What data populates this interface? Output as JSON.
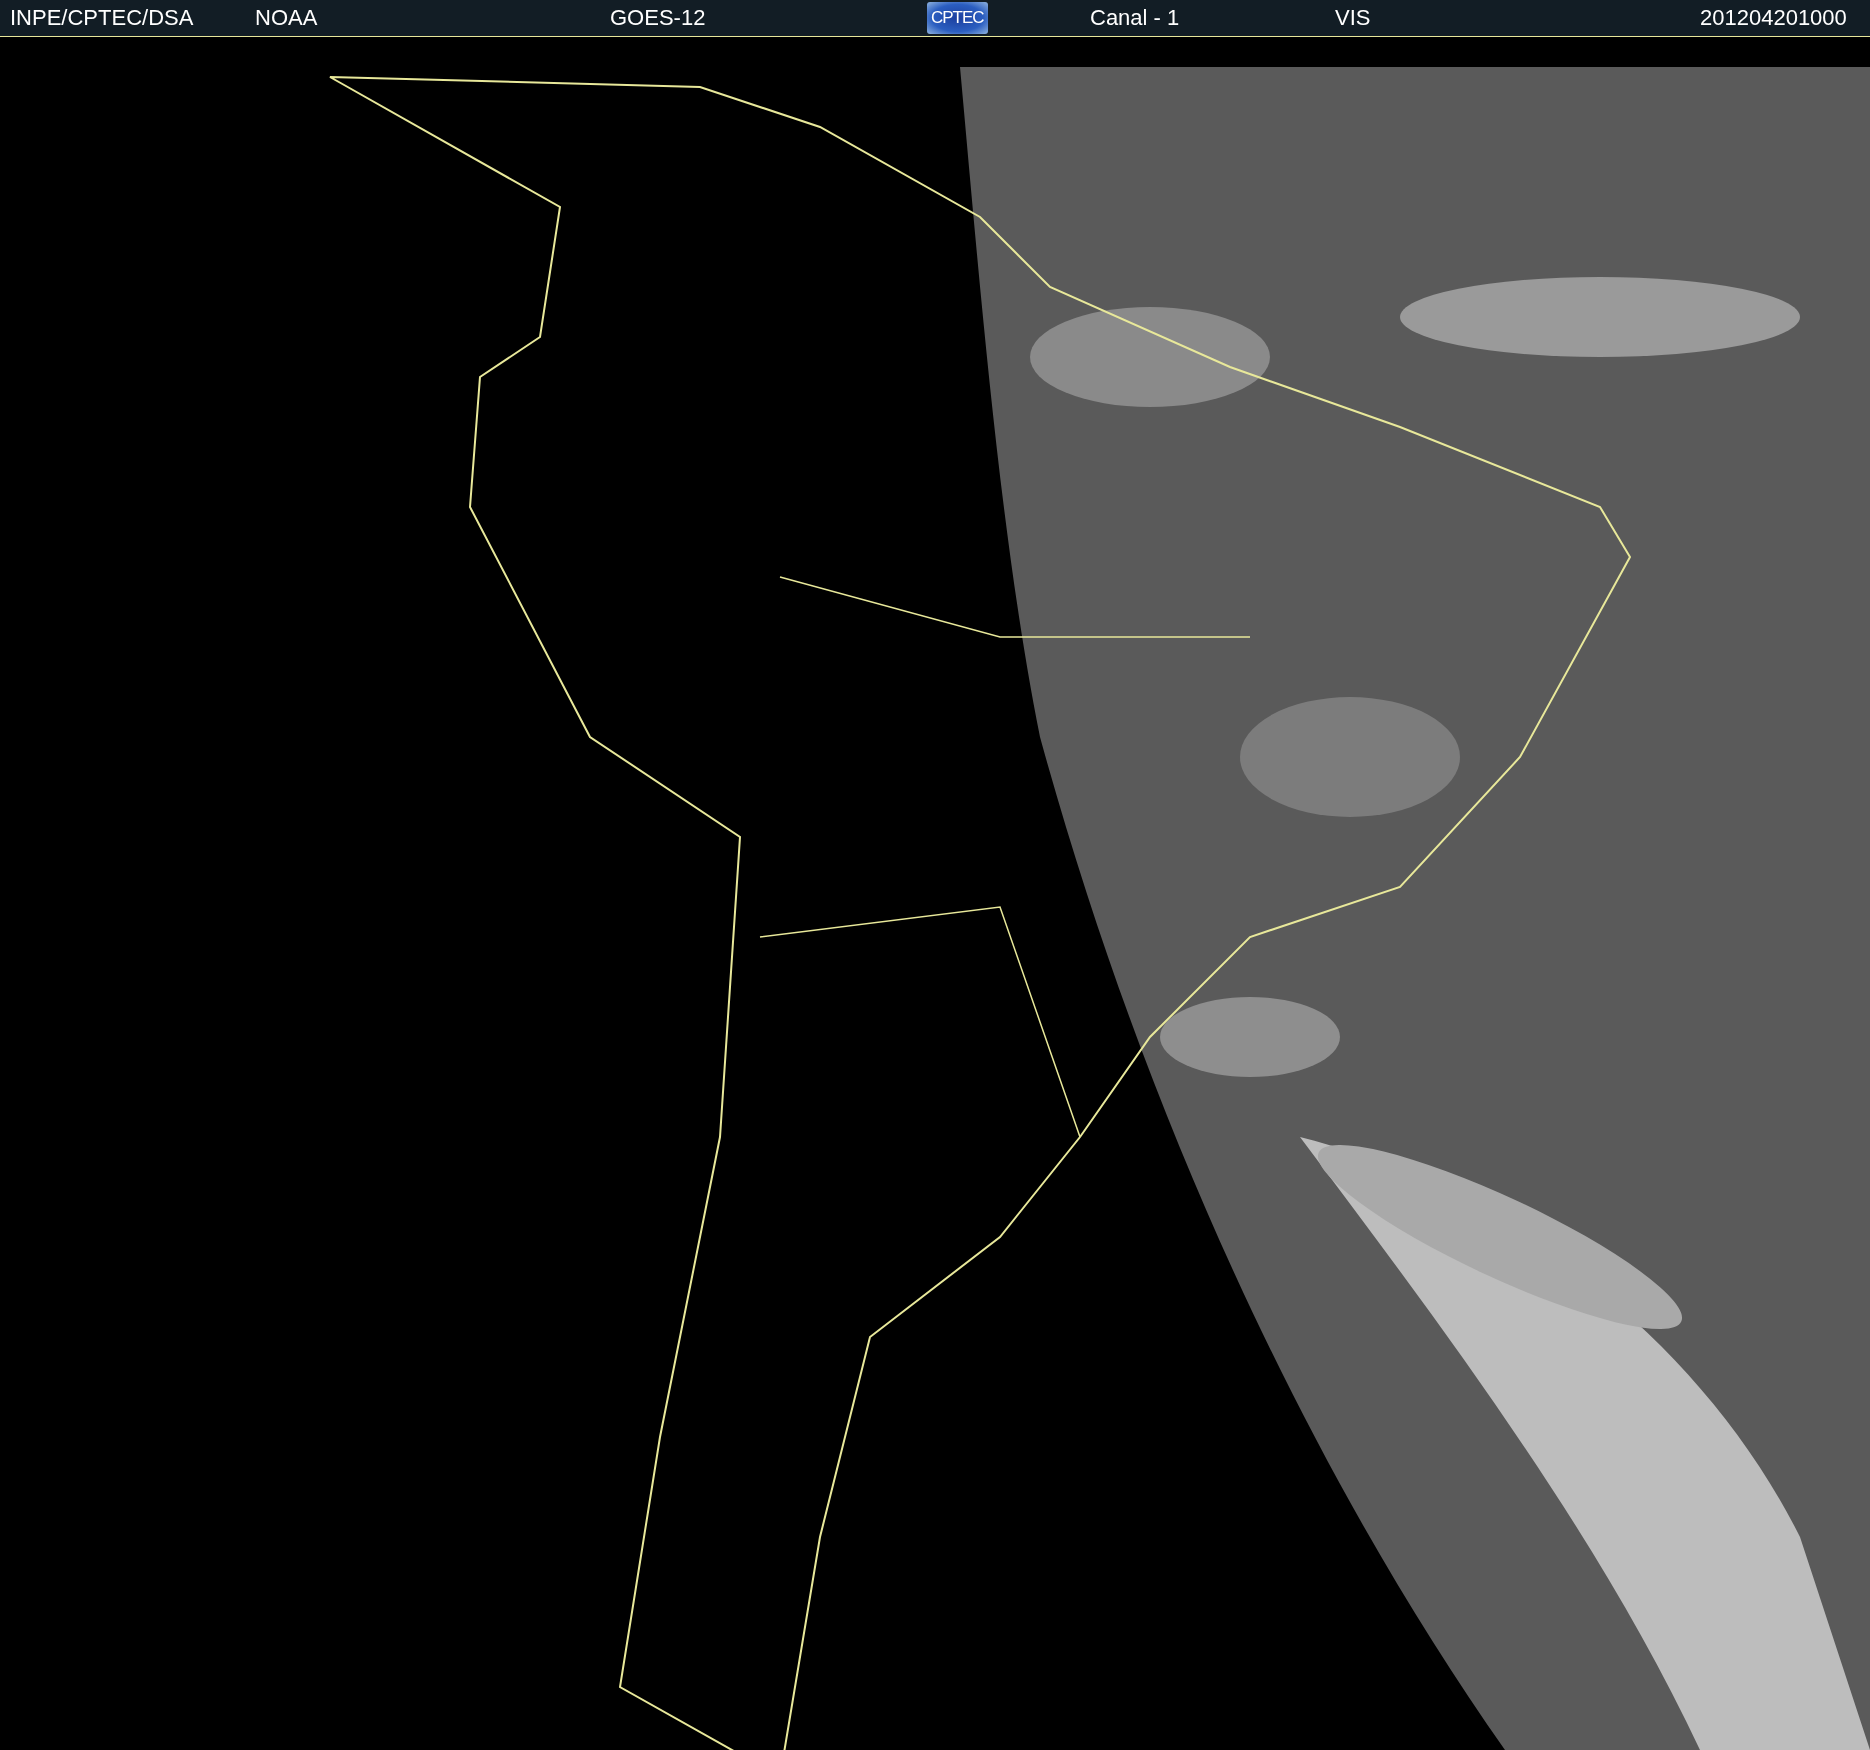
{
  "header": {
    "items": [
      {
        "kind": "text",
        "text": "INPE/CPTEC/DSA"
      },
      {
        "kind": "text",
        "text": "NOAA"
      },
      {
        "kind": "text",
        "text": "GOES-12"
      },
      {
        "kind": "logo",
        "text": "CPTEC"
      },
      {
        "kind": "text",
        "text": "Canal - 1"
      },
      {
        "kind": "text",
        "text": "VIS"
      },
      {
        "kind": "text",
        "text": "201204201000"
      }
    ]
  }
}
